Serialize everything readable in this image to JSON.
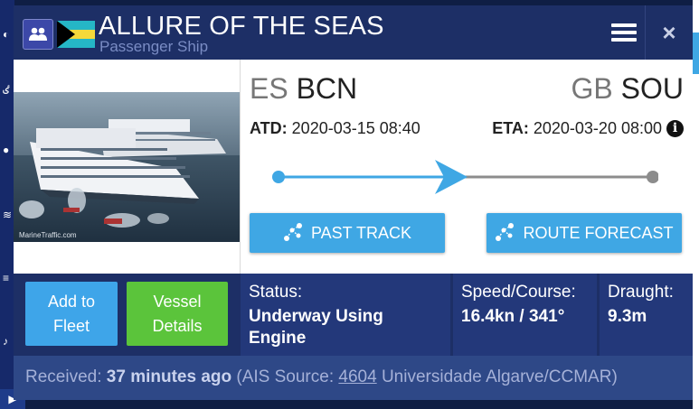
{
  "vessel": {
    "name": "ALLURE OF THE SEAS",
    "type": "Passenger Ship",
    "flag": "Bahamas"
  },
  "header": {
    "menu_icon": "hamburger-icon",
    "close_icon": "close-icon",
    "close_glyph": "×"
  },
  "photo": {
    "watermark": "MarineTraffic.com"
  },
  "route": {
    "departure_country": "ES",
    "departure_port": "BCN",
    "arrival_country": "GB",
    "arrival_port": "SOU",
    "atd_label": "ATD:",
    "atd_value": "2020-03-15 08:40",
    "eta_label": "ETA:",
    "eta_value": "2020-03-20 08:00",
    "info_glyph": "i",
    "progress": 0.5,
    "past_track_label": "PAST TRACK",
    "route_forecast_label": "ROUTE FORECAST"
  },
  "actions": {
    "add_to_fleet_line1": "Add to",
    "add_to_fleet_line2": "Fleet",
    "vessel_details_line1": "Vessel",
    "vessel_details_line2": "Details"
  },
  "status": {
    "status_label": "Status:",
    "status_line1": "Underway Using",
    "status_line2": "Engine",
    "speed_label": "Speed/Course:",
    "speed_value": "16.4kn / 341°",
    "draught_label": "Draught:",
    "draught_value": "9.3m"
  },
  "footer": {
    "received_label": "Received:",
    "received_value": "37 minutes ago",
    "ais_prefix": "(AIS Source:",
    "ais_station_id": "4604",
    "ais_station_name": "Universidade Algarve/CCMAR)"
  },
  "colors": {
    "popup_bg": "#1d2f66",
    "accent_blue": "#3fa7e4",
    "green": "#5bc43b",
    "track_grey": "#8c8c8c"
  }
}
